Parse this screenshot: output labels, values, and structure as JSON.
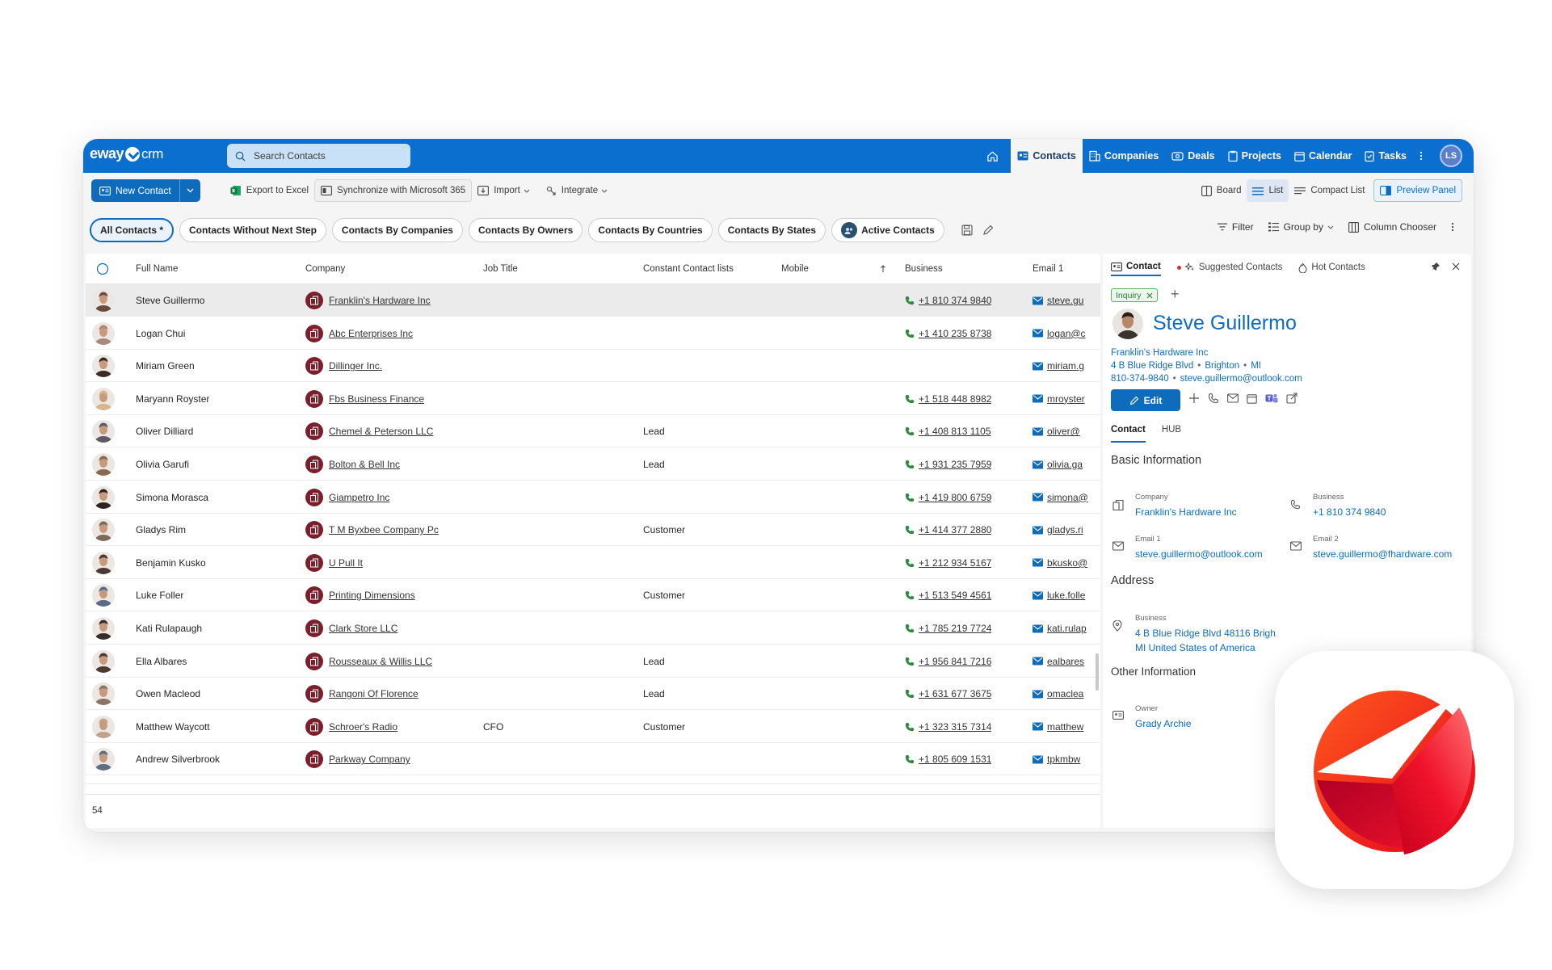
{
  "logo": {
    "brand": "eway",
    "product": "crm"
  },
  "search": {
    "placeholder": "Search Contacts"
  },
  "nav": {
    "items": [
      {
        "label": "Contacts",
        "icon": "contacts-icon"
      },
      {
        "label": "Companies",
        "icon": "building-icon"
      },
      {
        "label": "Deals",
        "icon": "deals-icon"
      },
      {
        "label": "Projects",
        "icon": "clipboard-icon"
      },
      {
        "label": "Calendar",
        "icon": "calendar-icon"
      },
      {
        "label": "Tasks",
        "icon": "task-icon"
      }
    ],
    "user_initials": "LS"
  },
  "toolbar": {
    "new_contact": "New Contact",
    "export": "Export to Excel",
    "sync": "Synchronize with Microsoft 365",
    "import": "Import",
    "integrate": "Integrate",
    "board": "Board",
    "list": "List",
    "compact_list": "Compact List",
    "preview_panel": "Preview Panel"
  },
  "chips": [
    "All Contacts *",
    "Contacts Without Next Step",
    "Contacts By Companies",
    "Contacts By Owners",
    "Contacts By Countries",
    "Contacts By States",
    "Active Contacts"
  ],
  "filters": {
    "filter": "Filter",
    "group_by": "Group by",
    "column_chooser": "Column Chooser"
  },
  "grid": {
    "columns": [
      "Full Name",
      "Company",
      "Job Title",
      "Constant Contact lists",
      "Mobile",
      "Business",
      "Email 1"
    ],
    "rows": [
      {
        "name": "Steve Guillermo",
        "company": "Franklin's Hardware Inc",
        "job": "",
        "lists": "",
        "phone": "+1 810 374 9840",
        "email": "steve.gu",
        "face": "#6b4a3a"
      },
      {
        "name": "Logan Chui",
        "company": "Abc Enterprises Inc",
        "job": "",
        "lists": "",
        "phone": "+1 410 235 8738",
        "email": "logan@c",
        "face": "#a8887a"
      },
      {
        "name": "Miriam Green",
        "company": "Dillinger Inc.",
        "job": "",
        "lists": "",
        "phone": "",
        "email": "miriam.g",
        "face": "#3b2a26"
      },
      {
        "name": "Maryann Royster",
        "company": "Fbs Business Finance",
        "job": "",
        "lists": "",
        "phone": "+1 518 448 8982",
        "email": "mroyster",
        "face": "#d9b48d"
      },
      {
        "name": "Oliver Dilliard",
        "company": "Chemel & Peterson LLC",
        "job": "",
        "lists": "Lead",
        "phone": "+1 408 813 1105",
        "email": "oliver@",
        "face": "#5b5b66"
      },
      {
        "name": "Olivia Garufi",
        "company": "Bolton & Bell Inc",
        "job": "",
        "lists": "Lead",
        "phone": "+1 931 235 7959",
        "email": "olivia.ga",
        "face": "#8a6a4e"
      },
      {
        "name": "Simona Morasca",
        "company": "Giampetro Inc",
        "job": "",
        "lists": "",
        "phone": "+1 419 800 6759",
        "email": "simona@",
        "face": "#2f2420"
      },
      {
        "name": "Gladys Rim",
        "company": "T M Byxbee Company Pc",
        "job": "",
        "lists": "Customer",
        "phone": "+1 414 377 2880",
        "email": "gladys.ri",
        "face": "#7a6a5a"
      },
      {
        "name": "Benjamin Kusko",
        "company": "U Pull It",
        "job": "",
        "lists": "",
        "phone": "+1 212 934 5167",
        "email": "bkusko@",
        "face": "#4a3a33"
      },
      {
        "name": "Luke Foller",
        "company": "Printing Dimensions",
        "job": "",
        "lists": "Customer",
        "phone": "+1 513 549 4561",
        "email": "luke.folle",
        "face": "#5a6b8a"
      },
      {
        "name": "Kati Rulapaugh",
        "company": "Clark Store LLC",
        "job": "",
        "lists": "",
        "phone": "+1 785 219 7724",
        "email": "kati.rulap",
        "face": "#3a2e2a"
      },
      {
        "name": "Ella Albares",
        "company": "Rousseaux & Willis LLC",
        "job": "",
        "lists": "Lead",
        "phone": "+1 956 841 7216",
        "email": "ealbares",
        "face": "#4e3b30"
      },
      {
        "name": "Owen Macleod",
        "company": "Rangoni Of Florence",
        "job": "",
        "lists": "Lead",
        "phone": "+1 631 677 3675",
        "email": "omaclea",
        "face": "#8d7563"
      },
      {
        "name": "Matthew Waycott",
        "company": "Schroer's Radio",
        "job": "CFO",
        "lists": "Customer",
        "phone": "+1 323 315 7314",
        "email": "matthew",
        "face": "#c2a28a"
      },
      {
        "name": "Andrew Silverbrook",
        "company": "Parkway Company",
        "job": "",
        "lists": "",
        "phone": "+1 805 609 1531",
        "email": "tpkmbw",
        "face": "#5f6f80"
      }
    ],
    "count": "54"
  },
  "panel": {
    "tabs": [
      "Contact",
      "Suggested Contacts",
      "Hot Contacts"
    ],
    "tag": "Inquiry",
    "name": "Steve Guillermo",
    "company": "Franklin's Hardware Inc",
    "street": "4 B Blue Ridge Blvd",
    "city": "Brighton",
    "state": "MI",
    "phone": "810-374-9840",
    "email": "steve.guillermo@outlook.com",
    "edit": "Edit",
    "subtabs": [
      "Contact",
      "HUB"
    ],
    "basic_info": "Basic Information",
    "company_label": "Company",
    "company_value": "Franklin's Hardware Inc",
    "business_label": "Business",
    "business_value": "+1 810 374 9840",
    "email1_label": "Email 1",
    "email1_value": "steve.guillermo@outlook.com",
    "email2_label": "Email 2",
    "email2_value": "steve.guillermo@fhardware.com",
    "address": "Address",
    "address_label": "Business",
    "address_line1": "4 B Blue Ridge Blvd 48116 Brigh",
    "address_line2": "MI United States of America",
    "other_info": "Other Information",
    "owner_label": "Owner",
    "owner_value": "Grady Archie"
  },
  "colors": {
    "brand": "#0a6fce",
    "accent": "#0f6cbd",
    "company_icon": "#7a1f2b",
    "phone_icon": "#2e8b3e"
  }
}
